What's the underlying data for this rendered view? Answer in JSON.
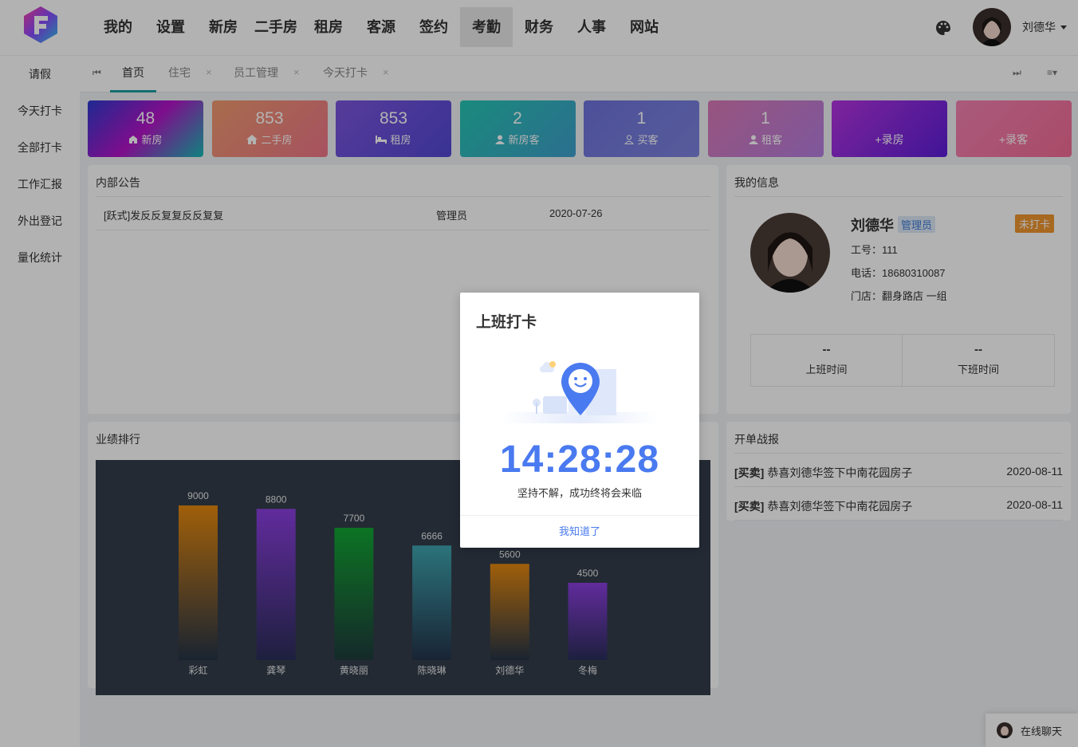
{
  "nav": [
    "我的",
    "设置",
    "新房",
    "二手房",
    "租房",
    "客源",
    "签约",
    "考勤",
    "财务",
    "人事",
    "网站"
  ],
  "nav_active": 7,
  "user": {
    "name": "刘德华"
  },
  "sidebar": [
    "请假",
    "今天打卡",
    "全部打卡",
    "工作汇报",
    "外出登记",
    "量化统计"
  ],
  "tabs": [
    {
      "label": "首页",
      "closable": false,
      "active": true
    },
    {
      "label": "住宅",
      "closable": true
    },
    {
      "label": "员工管理",
      "closable": true
    },
    {
      "label": "今天打卡",
      "closable": true
    }
  ],
  "tab_close_glyph": "×",
  "stats": [
    {
      "num": "48",
      "label": "新房",
      "icon": "house-icon",
      "gradient": [
        "#2d3bd1",
        "#b514c9",
        "#16bcb6"
      ]
    },
    {
      "num": "853",
      "label": "二手房",
      "icon": "home-icon",
      "gradient": [
        "#f09b6e",
        "#f0768a"
      ]
    },
    {
      "num": "853",
      "label": "租房",
      "icon": "bed-icon",
      "gradient": [
        "#7c55dd",
        "#5249d4"
      ]
    },
    {
      "num": "2",
      "label": "新房客",
      "icon": "user-icon",
      "gradient": [
        "#26c6b4",
        "#3fa0cd"
      ]
    },
    {
      "num": "1",
      "label": "买客",
      "icon": "user-outline-icon",
      "gradient": [
        "#6e73db",
        "#7d84e0"
      ]
    },
    {
      "num": "1",
      "label": "租客",
      "icon": "user-icon",
      "gradient": [
        "#d979b6",
        "#b57ee0"
      ]
    },
    {
      "num": "",
      "label": "+录房",
      "icon": "",
      "gradient": [
        "#b534e0",
        "#5b1ed8"
      ]
    },
    {
      "num": "",
      "label": "+录客",
      "icon": "",
      "gradient": [
        "#f482b1",
        "#f36c96"
      ]
    }
  ],
  "notice": {
    "title": "内部公告",
    "rows": [
      {
        "text": "[跃式]发反反复复反反复复",
        "author": "管理员",
        "date": "2020-07-26"
      }
    ]
  },
  "profile": {
    "title": "我的信息",
    "name": "刘德华",
    "role": "管理员",
    "badge": "未打卡",
    "job_no": "工号：111",
    "phone": "电话：18680310087",
    "store": "门店：翻身路店 一组",
    "checkin_value": "--",
    "checkin_label": "上班时间",
    "checkout_value": "--",
    "checkout_label": "下班时间"
  },
  "ranking": {
    "title": "业绩排行"
  },
  "chart_data": {
    "type": "bar",
    "categories": [
      "彩虹",
      "龚琴",
      "黄晓丽",
      "陈晓琳",
      "刘德华",
      "冬梅"
    ],
    "values": [
      9000,
      8800,
      7700,
      6666,
      5600,
      4500
    ],
    "ylim": [
      0,
      9000
    ],
    "colors": [
      [
        "#e5890f",
        "#253447"
      ],
      [
        "#8b3fe0",
        "#2b2e5a"
      ],
      [
        "#12a634",
        "#1f3b3c"
      ],
      [
        "#3fa5b0",
        "#24344c"
      ],
      [
        "#e5890f",
        "#253447"
      ],
      [
        "#8b3fe0",
        "#2b2e5a"
      ]
    ]
  },
  "news": {
    "title": "开单战报",
    "rows": [
      {
        "tag": "[买卖]",
        "text": "恭喜刘德华签下中南花园房子",
        "date": "2020-08-11"
      },
      {
        "tag": "[买卖]",
        "text": "恭喜刘德华签下中南花园房子",
        "date": "2020-08-11"
      }
    ]
  },
  "modal": {
    "title": "上班打卡",
    "time": "14:28:28",
    "motto": "坚持不解，成功终将会来临",
    "button": "我知道了"
  },
  "chat": {
    "label": "在线聊天"
  }
}
